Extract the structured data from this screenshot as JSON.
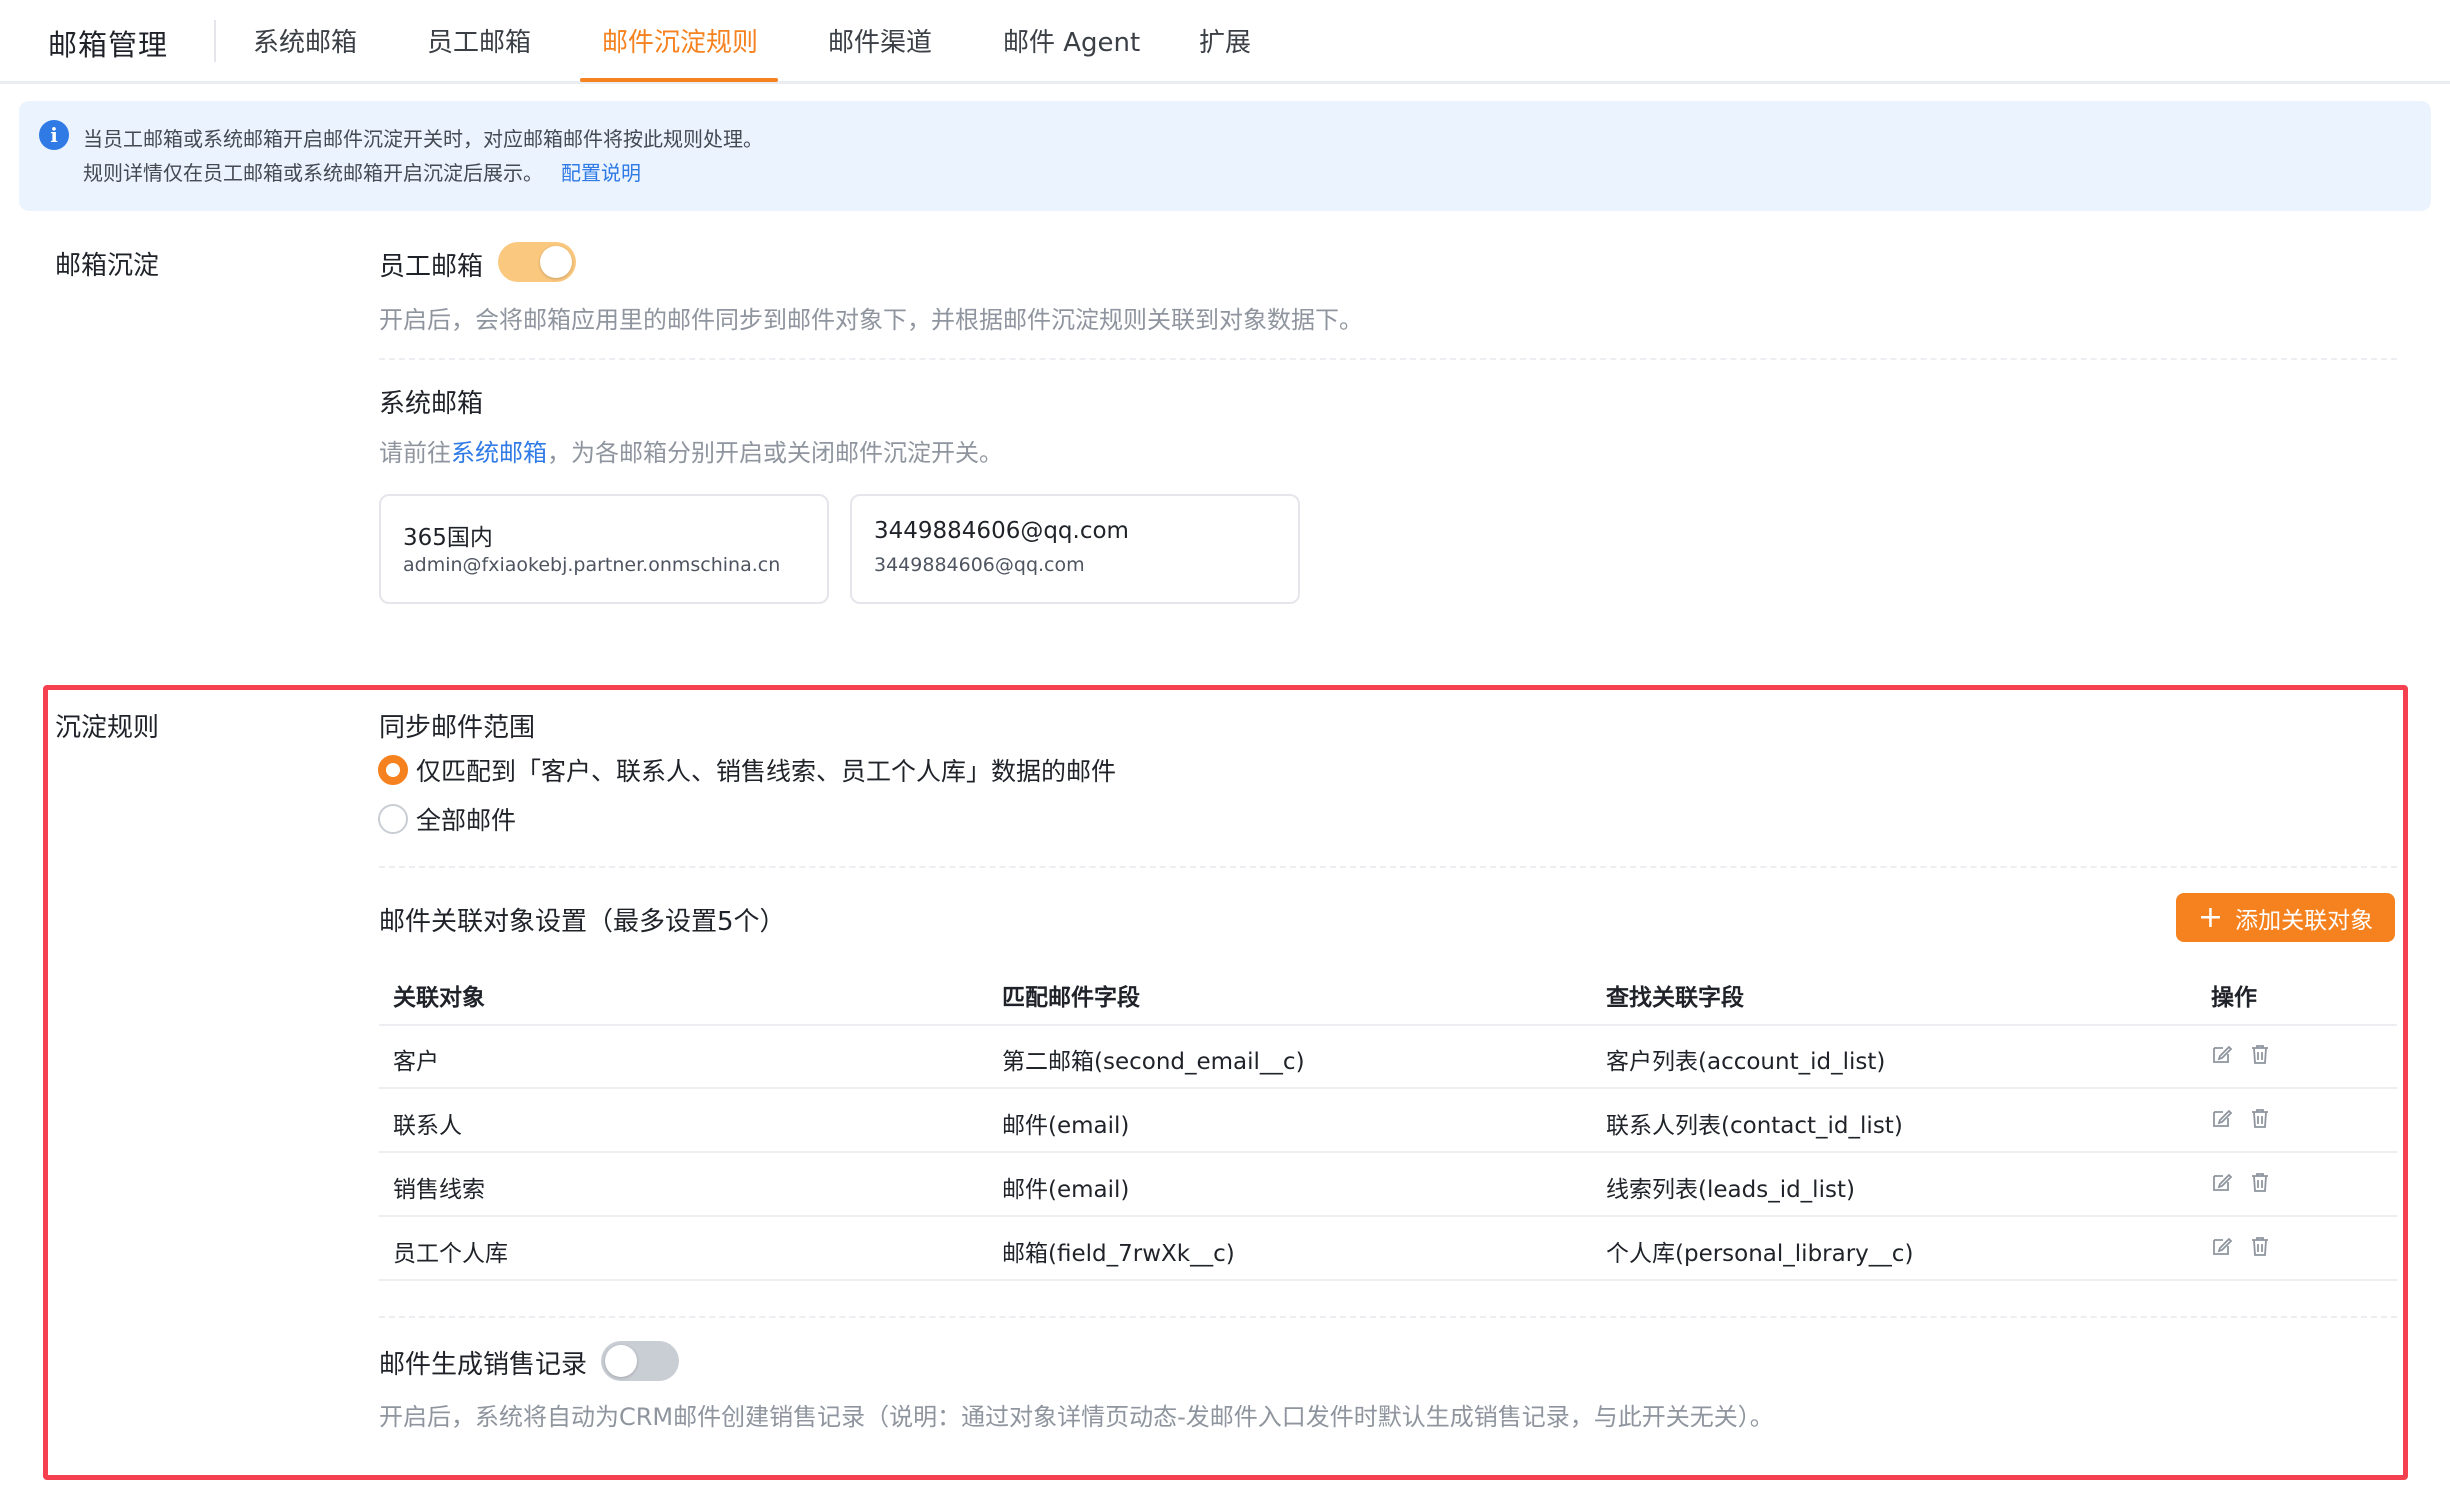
{
  "app": {
    "title": "邮箱管理"
  },
  "nav": {
    "tabs": [
      {
        "label": "系统邮箱"
      },
      {
        "label": "员工邮箱"
      },
      {
        "label": "邮件沉淀规则"
      },
      {
        "label": "邮件渠道"
      },
      {
        "label": "邮件 Agent"
      },
      {
        "label": "扩展"
      }
    ],
    "active_tab": "邮件沉淀规则"
  },
  "info": {
    "line1": "当员工邮箱或系统邮箱开启邮件沉淀开关时，对应邮箱邮件将按此规则处理。",
    "line2": "规则详情仅在员工邮箱或系统邮箱开启沉淀后展示。",
    "link": "配置说明"
  },
  "mailbox_section": {
    "label": "邮箱沉淀",
    "employee": {
      "title": "员工邮箱",
      "enabled": true,
      "desc": "开启后，会将邮箱应用里的邮件同步到邮件对象下，并根据邮件沉淀规则关联到对象数据下。"
    },
    "system": {
      "title": "系统邮箱",
      "desc_prefix": "请前往",
      "desc_link": "系统邮箱",
      "desc_suffix": "，为各邮箱分别开启或关闭邮件沉淀开关。",
      "cards": [
        {
          "name": "365国内",
          "email": "admin@fxiaokebj.partner.onmschina.cn"
        },
        {
          "name": "3449884606@qq.com",
          "email": "3449884606@qq.com"
        }
      ]
    }
  },
  "rules_section": {
    "label": "沉淀规则",
    "sync_scope": {
      "title": "同步邮件范围",
      "options": [
        {
          "label": "仅匹配到「客户、联系人、销售线索、员工个人库」数据的邮件",
          "checked": true
        },
        {
          "label": "全部邮件",
          "checked": false
        }
      ]
    },
    "association": {
      "title": "邮件关联对象设置（最多设置5个）",
      "add_button": "添加关联对象",
      "columns": [
        "关联对象",
        "匹配邮件字段",
        "查找关联字段",
        "操作"
      ],
      "rows": [
        [
          "客户",
          "第二邮箱(second_email__c)",
          "客户列表(account_id_list)"
        ],
        [
          "联系人",
          "邮件(email)",
          "联系人列表(contact_id_list)"
        ],
        [
          "销售线索",
          "邮件(email)",
          "线索列表(leads_id_list)"
        ],
        [
          "员工个人库",
          "邮箱(field_7rwXk__c)",
          "个人库(personal_library__c)"
        ]
      ]
    },
    "sales_record": {
      "title": "邮件生成销售记录",
      "enabled": false,
      "desc": "开启后，系统将自动为CRM邮件创建销售记录（说明：通过对象详情页动态-发邮件入口发件时默认生成销售记录，与此开关无关）。"
    }
  },
  "colors": {
    "accent": "#f5821f",
    "link": "#2f7ae5",
    "highlight_border": "#f5414f"
  }
}
